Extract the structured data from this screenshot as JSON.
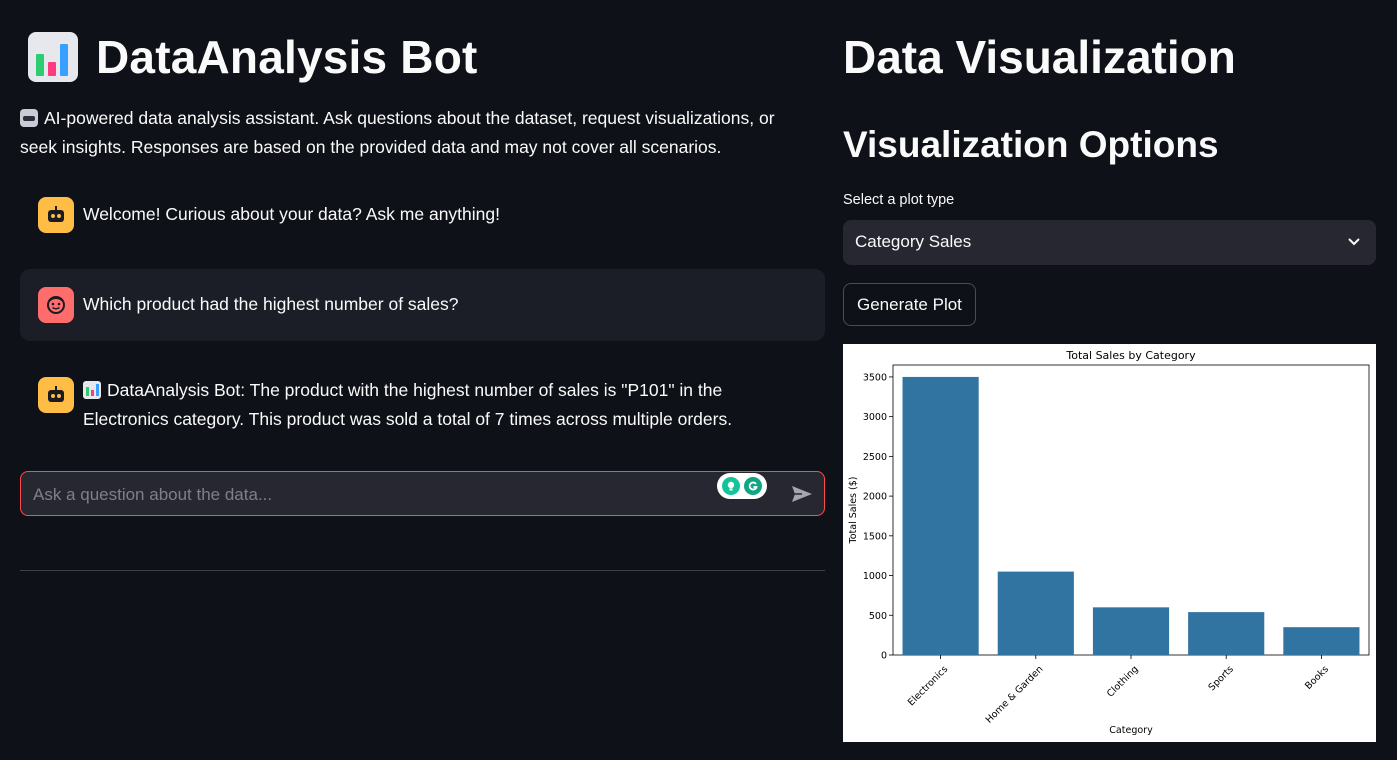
{
  "header": {
    "title": "DataAnalysis Bot",
    "description": "AI-powered data analysis assistant. Ask questions about the dataset, request visualizations, or seek insights. Responses are based on the provided data and may not cover all scenarios."
  },
  "chat": {
    "messages": [
      {
        "role": "assistant",
        "avatar": "robot-icon",
        "text": "Welcome! Curious about your data? Ask me anything!"
      },
      {
        "role": "user",
        "avatar": "face-icon",
        "text": "Which product had the highest number of sales?"
      },
      {
        "role": "assistant",
        "avatar": "robot-icon",
        "text": "DataAnalysis Bot: The product with the highest number of sales is \"P101\" in the Electronics category. This product was sold a total of 7 times across multiple orders."
      }
    ],
    "input": {
      "placeholder": "Ask a question about the data...",
      "value": ""
    }
  },
  "viz": {
    "heading": "Data Visualization",
    "options_heading": "Visualization Options",
    "select_label": "Select a plot type",
    "select_value": "Category Sales",
    "button_label": "Generate Plot"
  },
  "colors": {
    "background": "#0e1117",
    "bot_avatar": "#ffbd45",
    "user_avatar": "#ff6c6c",
    "input_border": "#ff4b4b",
    "bar": "#3274a1"
  },
  "chart_data": {
    "type": "bar",
    "title": "Total Sales by Category",
    "xlabel": "Category",
    "ylabel": "Total Sales ($)",
    "categories": [
      "Electronics",
      "Home & Garden",
      "Clothing",
      "Sports",
      "Books"
    ],
    "values": [
      3500,
      1050,
      600,
      540,
      350
    ],
    "ylim": [
      0,
      3650
    ],
    "yticks": [
      0,
      500,
      1000,
      1500,
      2000,
      2500,
      3000,
      3500
    ],
    "grid": false
  }
}
